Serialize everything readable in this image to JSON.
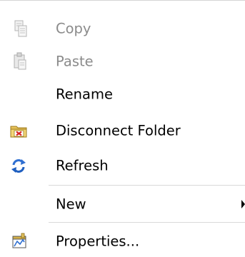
{
  "context_menu": {
    "items": [
      {
        "label": "Copy",
        "icon": "copy-icon",
        "enabled": false
      },
      {
        "label": "Paste",
        "icon": "paste-icon",
        "enabled": false
      },
      {
        "label": "Rename",
        "icon": "",
        "enabled": true
      },
      {
        "label": "Disconnect Folder",
        "icon": "disconnect-folder-icon",
        "enabled": true
      },
      {
        "label": "Refresh",
        "icon": "refresh-icon",
        "enabled": true
      },
      {
        "label": "New",
        "icon": "",
        "enabled": true,
        "has_submenu": true
      },
      {
        "label": "Properties...",
        "icon": "properties-icon",
        "enabled": true
      }
    ]
  },
  "colors": {
    "disabled_text": "#8b8b8b",
    "text": "#000000",
    "separator": "#d9d9d9"
  }
}
